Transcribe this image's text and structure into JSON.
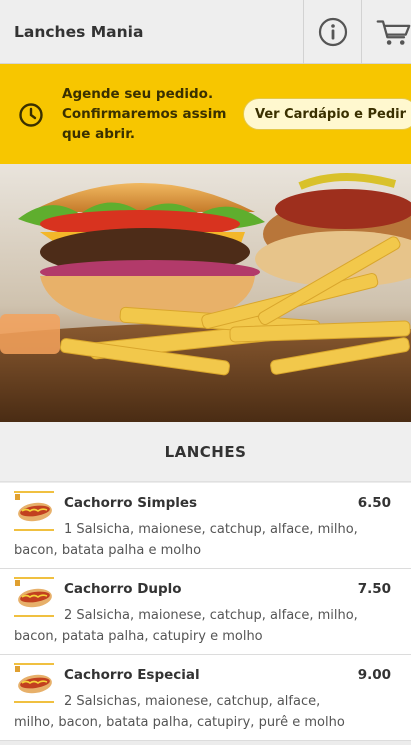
{
  "header": {
    "title": "Lanches Mania",
    "info_icon": "info-circle-icon",
    "cart_icon": "shopping-cart-icon"
  },
  "banner": {
    "icon": "clock-icon",
    "line1": "Agende seu pedido.",
    "line2": "Confirmaremos assim que abrir.",
    "button_label": "Ver Cardápio e Pedir",
    "color": "#f7c600"
  },
  "hero": {
    "image": "burger-hotdog-fries-photo"
  },
  "section": {
    "title": "LANCHES"
  },
  "items": [
    {
      "name": "Cachorro Simples",
      "price": "6.50",
      "description": "1 Salsicha, maionese, catchup, alface, milho, bacon, batata palha e molho",
      "thumb_icon": "hotdog-thumbnail"
    },
    {
      "name": "Cachorro Duplo",
      "price": "7.50",
      "description": "2 Salsicha, maionese, catchup, alface, milho, bacon, patata palha, catupiry e molho",
      "thumb_icon": "hotdog-thumbnail"
    },
    {
      "name": "Cachorro Especial",
      "price": "9.00",
      "description": "2 Salsichas, maionese, catchup, alface, milho, bacon, batata palha, catupiry, purê e molho",
      "thumb_icon": "hotdog-thumbnail"
    }
  ]
}
